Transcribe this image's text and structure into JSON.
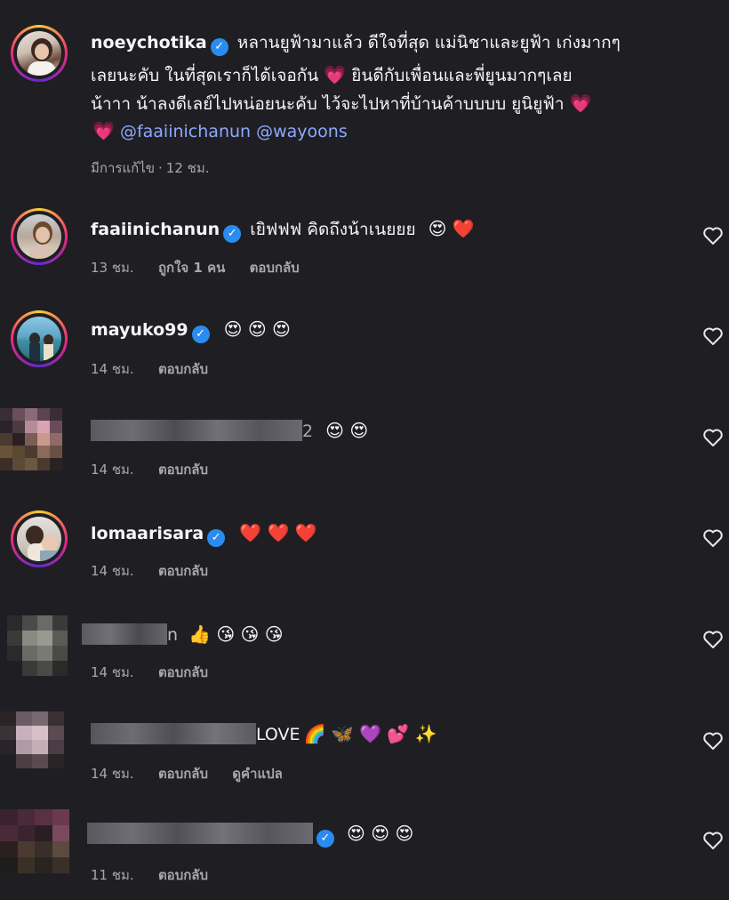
{
  "post": {
    "username": "noeychotika",
    "caption_line1": "หลานยูฟ้ามาแล้ว ดีใจที่สุด แม่นิชาและยูฟ้า เก่งมากๆ",
    "caption_line2_a": "เลยนะคับ ในที่สุดเราก็ได้เจอกัน",
    "caption_line2_b": "ยินดีกับเพื่อนและพี่ยูนมากๆเลย",
    "caption_line3": "น้าาา น้าลงดีเลย์ไปหน่อยนะคับ ไว้จะไปหาที่บ้านค้าบบบบ ยูนิยูฟ้า",
    "mention1": "@faaiinichanun",
    "mention2": "@wayoons",
    "edited": "มีการแก้ไข",
    "time": "12 ชม.",
    "heart_emoji": "💗"
  },
  "comments": [
    {
      "username": "faaiinichanun",
      "text": "เยิฟฟฟ คิดถึงน้าเนยยย",
      "emojis": "😍 ❤️",
      "time": "13 ชม.",
      "likes": "ถูกใจ 1 คน",
      "reply": "ตอบกลับ"
    },
    {
      "username": "mayuko99",
      "text": "",
      "emojis": "😍 😍 😍",
      "time": "14 ชม.",
      "reply": "ตอบกลับ"
    },
    {
      "username_suffix": "2",
      "emojis": "😍 😍",
      "time": "14 ชม.",
      "reply": "ตอบกลับ"
    },
    {
      "username": "lomaarisara",
      "emojis": "❤️ ❤️ ❤️",
      "time": "14 ชม.",
      "reply": "ตอบกลับ"
    },
    {
      "username_suffix": "n",
      "emojis": "👍 😘 😘 😘",
      "time": "14 ชม.",
      "reply": "ตอบกลับ"
    },
    {
      "text": "LOVE",
      "emojis": "🌈 🦋 💜 💕 ✨",
      "time": "14 ชม.",
      "reply": "ตอบกลับ",
      "translate": "ดูคำแปล"
    },
    {
      "emojis": "😍 😍 😍",
      "time": "11 ชม.",
      "reply": "ตอบกลับ"
    }
  ],
  "separator": "·",
  "icons": {
    "verified": "verified-badge-icon",
    "like": "heart-outline-icon"
  }
}
